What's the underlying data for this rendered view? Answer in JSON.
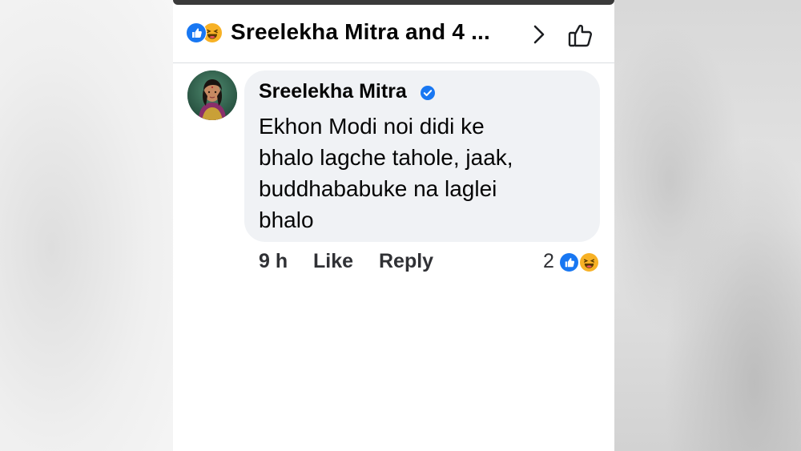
{
  "header": {
    "title": "Sreelekha Mitra and 4 ...",
    "reaction_icons": [
      "like-reaction-icon",
      "haha-reaction-icon"
    ],
    "forward_icon": "chevron-right-icon",
    "like_icon": "thumbs-up-outline-icon"
  },
  "comment": {
    "author": "Sreelekha Mitra",
    "verified_icon": "verified-badge-icon",
    "text_lines": [
      "Ekhon Modi noi didi ke",
      "bhalo lagche tahole, jaak,",
      "buddhababuke na laglei",
      "bhalo"
    ],
    "time": "9 h",
    "like_label": "Like",
    "reply_label": "Reply",
    "reaction_count": "2",
    "reaction_icons": [
      "like-reaction-icon",
      "haha-reaction-icon"
    ]
  },
  "colors": {
    "facebook_blue": "#1877f2",
    "haha_yellow": "#f7b125",
    "bubble_bg": "#f0f2f5",
    "text": "#050505"
  }
}
